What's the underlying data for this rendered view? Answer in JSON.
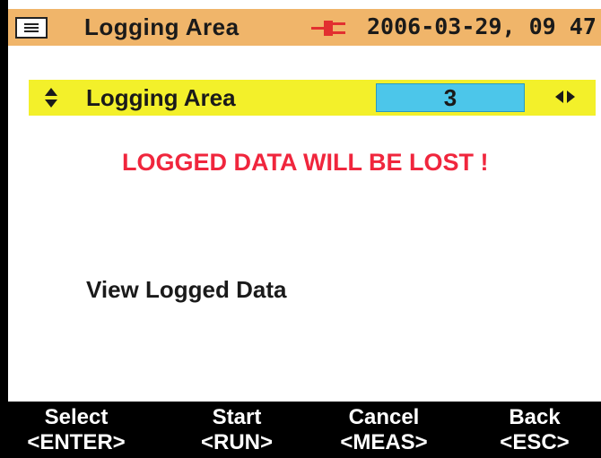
{
  "header": {
    "title": "Logging Area",
    "datetime": "2006-03-29, 09 47",
    "icon": "menu-icon",
    "status_icon": "power-plug-icon"
  },
  "row": {
    "label": "Logging Area",
    "value": "3",
    "left_icon": "updown-arrows-icon",
    "right_icon": "leftright-arrows-icon"
  },
  "warning": "LOGGED DATA WILL BE LOST !",
  "menu_item": "View Logged Data",
  "function_keys": [
    {
      "label": "Select",
      "key": "<ENTER>"
    },
    {
      "label": "Start",
      "key": "<RUN>"
    },
    {
      "label": "Cancel",
      "key": "<MEAS>"
    },
    {
      "label": "Back",
      "key": "<ESC>"
    }
  ],
  "colors": {
    "header_bg": "#f0b56a",
    "row_highlight": "#f3f02a",
    "value_box": "#4cc6ea",
    "warning": "#f0263d",
    "fkey_bar": "#000000"
  }
}
